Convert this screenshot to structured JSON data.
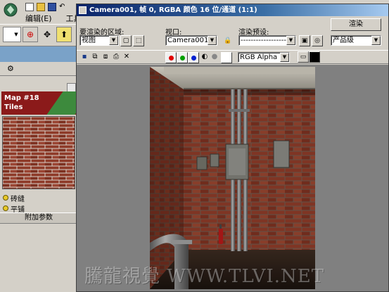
{
  "app": {
    "menu": [
      "编辑(E)",
      "工具(T)"
    ],
    "map_name": "Map #18",
    "map_type": "Tiles",
    "params": [
      "砖缝",
      "平铺"
    ],
    "extra_params": "附加参数"
  },
  "framebuffer": {
    "title": "Camera001, 帧 0, RGBA 颜色 16 位/通道 (1:1)",
    "area_label": "要渲染的区域:",
    "area_value": "视图",
    "viewport_label": "视口:",
    "viewport_value": "Camera001",
    "preset_label": "渲染预设:",
    "preset_value": "--------------------",
    "render_button": "渲染",
    "quality_value": "产品级",
    "channel_value": "RGB Alpha",
    "channel_colors": [
      "#e00000",
      "#00a000",
      "#0020d0"
    ]
  },
  "watermark": "騰龍視覺 WWW.TLVI.NET"
}
